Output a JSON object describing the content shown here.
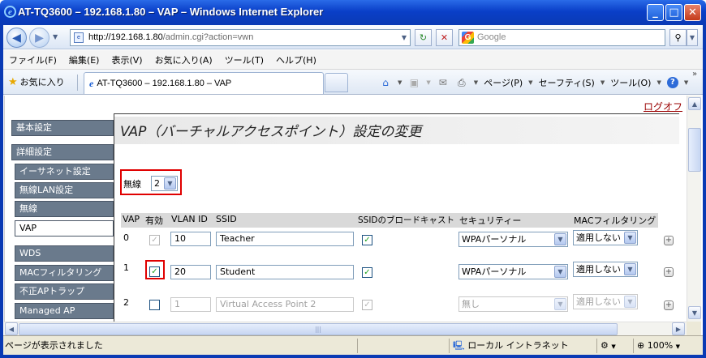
{
  "window": {
    "title": "AT-TQ3600 – 192.168.1.80 – VAP – Windows Internet Explorer",
    "controls": {
      "minimize": "_",
      "maximize": "□",
      "close": "✕"
    }
  },
  "address": {
    "url_host": "http://192.168.1.80",
    "url_rest": "/admin.cgi?action=vwn",
    "search_placeholder": "Google"
  },
  "menu": [
    "ファイル(F)",
    "編集(E)",
    "表示(V)",
    "お気に入り(A)",
    "ツール(T)",
    "ヘルプ(H)"
  ],
  "favorites": {
    "label": "お気に入り",
    "tab_title": "AT-TQ3600 – 192.168.1.80 – VAP",
    "commands": {
      "page": "ページ(P)",
      "safety": "セーフティ(S)",
      "tools": "ツール(O)"
    }
  },
  "page": {
    "logoff": "ログオフ",
    "title": "VAP（バーチャルアクセスポイント）設定の変更",
    "nav": [
      "基本設定",
      "詳細設定",
      "イーサネット設定",
      "無線LAN設定",
      "無線",
      "VAP",
      "WDS",
      "MACフィルタリング",
      "不正APトラップ",
      "Managed AP"
    ],
    "radio_label": "無線",
    "radio_value": "2",
    "columns": [
      "VAP",
      "有効",
      "VLAN ID",
      "SSID",
      "SSIDのブロードキャスト",
      "セキュリティー",
      "MACフィルタリング"
    ],
    "rows": [
      {
        "vap": "0",
        "enabled": true,
        "vlan": "10",
        "ssid": "Teacher",
        "broadcast": true,
        "security": "WPAパーソナル",
        "mac": "適用しない",
        "disabled": false
      },
      {
        "vap": "1",
        "enabled": true,
        "vlan": "20",
        "ssid": "Student",
        "broadcast": true,
        "security": "WPAパーソナル",
        "mac": "適用しない",
        "disabled": false
      },
      {
        "vap": "2",
        "enabled": false,
        "vlan": "1",
        "ssid": "Virtual Access Point 2",
        "broadcast": true,
        "security": "無し",
        "mac": "適用しない",
        "disabled": true
      }
    ]
  },
  "status": {
    "text": "ページが表示されました",
    "zone": "ローカル イントラネット",
    "zoom": "100%"
  }
}
